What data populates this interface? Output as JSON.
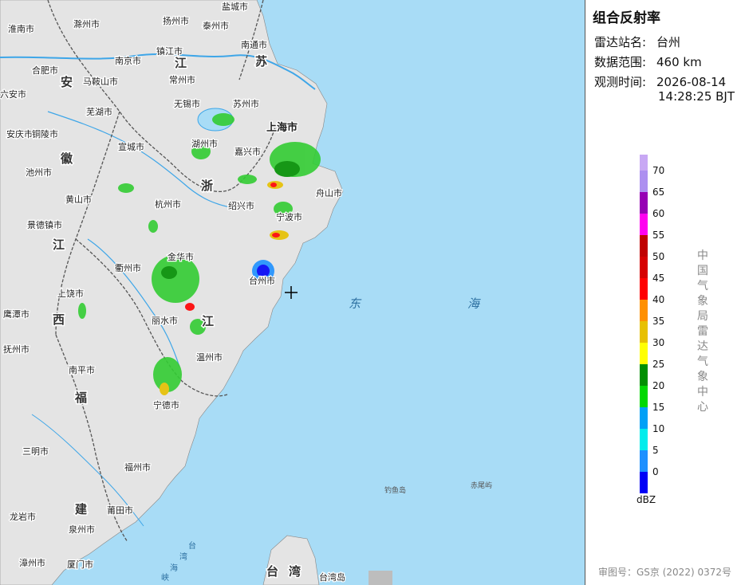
{
  "info": {
    "title": "组合反射率",
    "station_label": "雷达站名:",
    "station_value": "台州",
    "range_label": "数据范围:",
    "range_value": "460 km",
    "time_label": "观测时间:",
    "time_date": "2026-08-14",
    "time_clock": "14:28:25 BJT"
  },
  "legend": {
    "unit": "dBZ",
    "ticks": [
      "70",
      "65",
      "60",
      "55",
      "50",
      "45",
      "40",
      "35",
      "30",
      "25",
      "20",
      "15",
      "10",
      "5",
      "0"
    ],
    "colors": [
      "#ad90f0",
      "#9600b4",
      "#ff00f0",
      "#c00000",
      "#d60000",
      "#ff0000",
      "#ff9000",
      "#e7c000",
      "#ffff00",
      "#008f00",
      "#00d800",
      "#01a0f6",
      "#00ecec",
      "#1e90ff",
      "#0000f6"
    ]
  },
  "credit": "中国气象局雷达气象中心",
  "approval": "审图号：GS京 (2022) 0372号",
  "colors": {
    "sea": "#a8dcf6",
    "land": "#e6e6e6",
    "boundary": "#555555",
    "river": "#3ea6e8"
  },
  "map": {
    "radar_marker": "crosshair-icon",
    "provinces": [
      "安",
      "徽",
      "江",
      "苏",
      "浙",
      "江",
      "江",
      "西",
      "福",
      "建",
      "台",
      "湾"
    ],
    "cities": [
      "淮南市",
      "滁州市",
      "扬州市",
      "泰州市",
      "盐城市",
      "南通市",
      "合肥市",
      "南京市",
      "镇江市",
      "常州市",
      "六安市",
      "马鞍山市",
      "无锡市",
      "苏州市",
      "上海市",
      "芜湖市",
      "安庆市",
      "铜陵市",
      "宣城市",
      "湖州市",
      "嘉兴市",
      "池州市",
      "舟山市",
      "黄山市",
      "杭州市",
      "绍兴市",
      "宁波市",
      "景德镇市",
      "衢州市",
      "金华市",
      "台州市",
      "上饶市",
      "丽水市",
      "鹰潭市",
      "温州市",
      "抚州市",
      "南平市",
      "宁德市",
      "三明市",
      "福州市",
      "莆田市",
      "龙岩市",
      "泉州市",
      "厦门市",
      "漳州市",
      "台湾岛"
    ],
    "islands": [
      "钓鱼岛",
      "赤尾屿"
    ],
    "seas": [
      "东",
      "海",
      "台",
      "湾",
      "海",
      "峡"
    ]
  }
}
